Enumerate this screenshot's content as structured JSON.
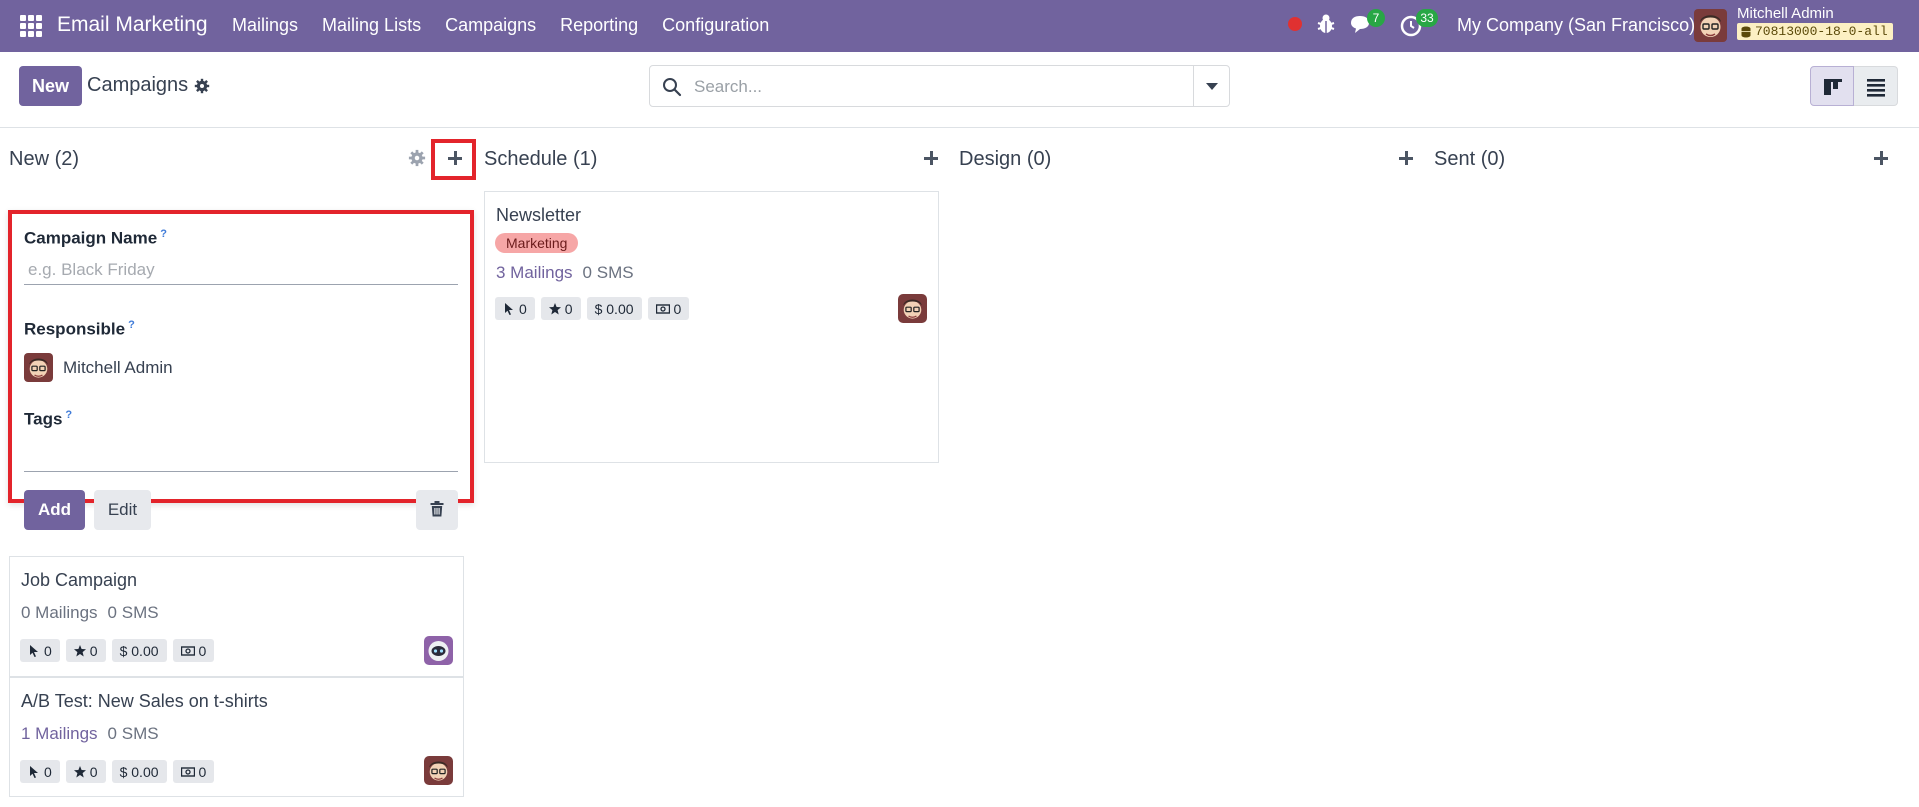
{
  "navbar": {
    "app_name": "Email Marketing",
    "menu": [
      "Mailings",
      "Mailing Lists",
      "Campaigns",
      "Reporting",
      "Configuration"
    ],
    "messages_count": "7",
    "activities_count": "33",
    "company": "My Company (San Francisco)",
    "user_name": "Mitchell Admin",
    "db_name": "70813000-18-0-all"
  },
  "control_panel": {
    "new_label": "New",
    "breadcrumb": "Campaigns",
    "search_placeholder": "Search..."
  },
  "columns": [
    {
      "title": "New (2)"
    },
    {
      "title": "Schedule (1)"
    },
    {
      "title": "Design (0)"
    },
    {
      "title": "Sent (0)"
    }
  ],
  "quick_create": {
    "name_label": "Campaign Name",
    "name_placeholder": "e.g. Black Friday",
    "responsible_label": "Responsible",
    "responsible_value": "Mitchell Admin",
    "tags_label": "Tags",
    "help_mark": "?",
    "add_label": "Add",
    "edit_label": "Edit"
  },
  "cards": {
    "job_campaign": {
      "title": "Job Campaign",
      "mailings": "0 Mailings",
      "sms": "0 SMS",
      "clicks": "0",
      "rating": "0",
      "revenue": "$ 0.00",
      "cash": "0"
    },
    "ab_test": {
      "title": "A/B Test: New Sales on t-shirts",
      "mailings": "1 Mailings",
      "sms": "0 SMS",
      "clicks": "0",
      "rating": "0",
      "revenue": "$ 0.00",
      "cash": "0"
    },
    "newsletter": {
      "title": "Newsletter",
      "tag": "Marketing",
      "mailings": "3 Mailings",
      "sms": "0 SMS",
      "clicks": "0",
      "rating": "0",
      "revenue": "$ 0.00",
      "cash": "0"
    }
  },
  "colors": {
    "brand": "#71639e",
    "highlight": "#e3242b",
    "tag_marketing": "#f6a6a6",
    "badge_green": "#28a745"
  }
}
